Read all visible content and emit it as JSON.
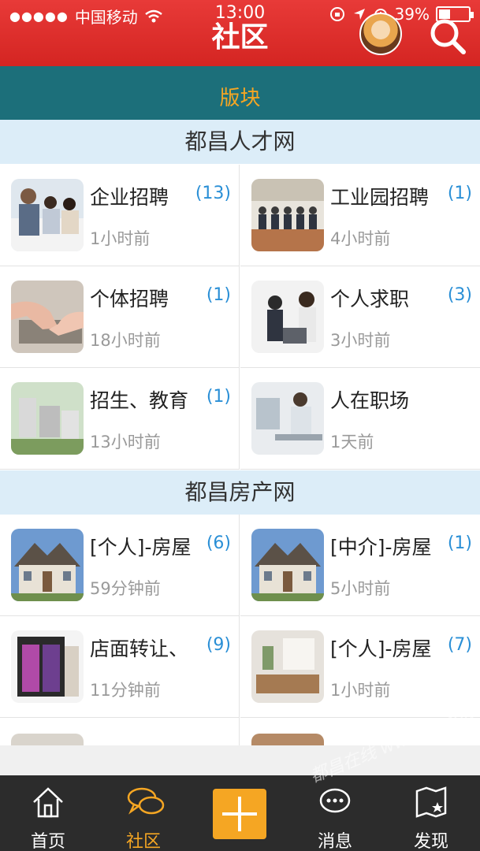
{
  "status_bar": {
    "signal_dots": "●●●●●",
    "carrier": "中国移动",
    "time": "13:00",
    "battery": "39%"
  },
  "header": {
    "title": "社区"
  },
  "section_tab": {
    "label": "版块"
  },
  "groups": [
    {
      "title": "都昌人才网",
      "items": [
        {
          "title": "企业招聘",
          "count": "(13)",
          "time": "1小时前"
        },
        {
          "title": "工业园招聘",
          "count": "(1)",
          "time": "4小时前"
        },
        {
          "title": "个体招聘",
          "count": "(1)",
          "time": "18小时前"
        },
        {
          "title": "个人求职",
          "count": "(3)",
          "time": "3小时前"
        },
        {
          "title": "招生、教育",
          "count": "(1)",
          "time": "13小时前"
        },
        {
          "title": "人在职场",
          "count": "",
          "time": "1天前"
        }
      ]
    },
    {
      "title": "都昌房产网",
      "items": [
        {
          "title": "[个人]-房屋",
          "count": "(6)",
          "time": "59分钟前"
        },
        {
          "title": "[中介]-房屋",
          "count": "(1)",
          "time": "5小时前"
        },
        {
          "title": "店面转让、",
          "count": "(9)",
          "time": "11分钟前"
        },
        {
          "title": "[个人]-房屋",
          "count": "(7)",
          "time": "1小时前"
        }
      ]
    }
  ],
  "tabbar": {
    "home": "首页",
    "community": "社区",
    "messages": "消息",
    "discover": "发现"
  },
  "watermark": "都昌在线 www.duchang.org",
  "colors": {
    "header_red": "#d42522",
    "section_teal": "#1c6f7a",
    "accent_orange": "#f5a623",
    "count_blue": "#2a8fd6"
  }
}
